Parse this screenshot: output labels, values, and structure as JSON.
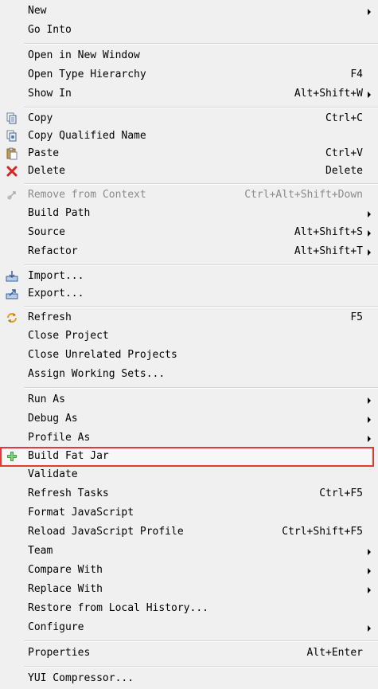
{
  "menu": {
    "items": [
      {
        "label": "New",
        "shortcut": "",
        "submenu": true
      },
      {
        "label": "Go Into",
        "shortcut": "",
        "submenu": false
      },
      {
        "label": "Open in New Window",
        "shortcut": "",
        "submenu": false
      },
      {
        "label": "Open Type Hierarchy",
        "shortcut": "F4",
        "submenu": false
      },
      {
        "label": "Show In",
        "shortcut": "Alt+Shift+W",
        "submenu": true
      },
      {
        "label": "Copy",
        "shortcut": "Ctrl+C",
        "submenu": false,
        "icon": "copy-icon"
      },
      {
        "label": "Copy Qualified Name",
        "shortcut": "",
        "submenu": false,
        "icon": "copy-qualified-name-icon"
      },
      {
        "label": "Paste",
        "shortcut": "Ctrl+V",
        "submenu": false,
        "icon": "paste-icon"
      },
      {
        "label": "Delete",
        "shortcut": "Delete",
        "submenu": false,
        "icon": "delete-icon"
      },
      {
        "label": "Remove from Context",
        "shortcut": "Ctrl+Alt+Shift+Down",
        "submenu": false,
        "disabled": true,
        "icon": "remove-from-context-icon"
      },
      {
        "label": "Build Path",
        "shortcut": "",
        "submenu": true
      },
      {
        "label": "Source",
        "shortcut": "Alt+Shift+S",
        "submenu": true
      },
      {
        "label": "Refactor",
        "shortcut": "Alt+Shift+T",
        "submenu": true
      },
      {
        "label": "Import...",
        "shortcut": "",
        "submenu": false,
        "icon": "import-icon"
      },
      {
        "label": "Export...",
        "shortcut": "",
        "submenu": false,
        "icon": "export-icon"
      },
      {
        "label": "Refresh",
        "shortcut": "F5",
        "submenu": false,
        "icon": "refresh-icon"
      },
      {
        "label": "Close Project",
        "shortcut": "",
        "submenu": false
      },
      {
        "label": "Close Unrelated Projects",
        "shortcut": "",
        "submenu": false
      },
      {
        "label": "Assign Working Sets...",
        "shortcut": "",
        "submenu": false
      },
      {
        "label": "Run As",
        "shortcut": "",
        "submenu": true
      },
      {
        "label": "Debug As",
        "shortcut": "",
        "submenu": true
      },
      {
        "label": "Profile As",
        "shortcut": "",
        "submenu": true
      },
      {
        "label": "Build Fat Jar",
        "shortcut": "",
        "submenu": false,
        "icon": "add-icon"
      },
      {
        "label": "Validate",
        "shortcut": "",
        "submenu": false
      },
      {
        "label": "Refresh Tasks",
        "shortcut": "Ctrl+F5",
        "submenu": false
      },
      {
        "label": "Format JavaScript",
        "shortcut": "",
        "submenu": false
      },
      {
        "label": "Reload JavaScript Profile",
        "shortcut": "Ctrl+Shift+F5",
        "submenu": false
      },
      {
        "label": "Team",
        "shortcut": "",
        "submenu": true
      },
      {
        "label": "Compare With",
        "shortcut": "",
        "submenu": true
      },
      {
        "label": "Replace With",
        "shortcut": "",
        "submenu": true
      },
      {
        "label": "Restore from Local History...",
        "shortcut": "",
        "submenu": false
      },
      {
        "label": "Configure",
        "shortcut": "",
        "submenu": true
      },
      {
        "label": "Properties",
        "shortcut": "Alt+Enter",
        "submenu": false
      },
      {
        "label": "YUI Compressor...",
        "shortcut": "",
        "submenu": false
      }
    ]
  },
  "colors": {
    "highlight_border": "#e03a3a",
    "menu_background": "#f0f0f0"
  }
}
